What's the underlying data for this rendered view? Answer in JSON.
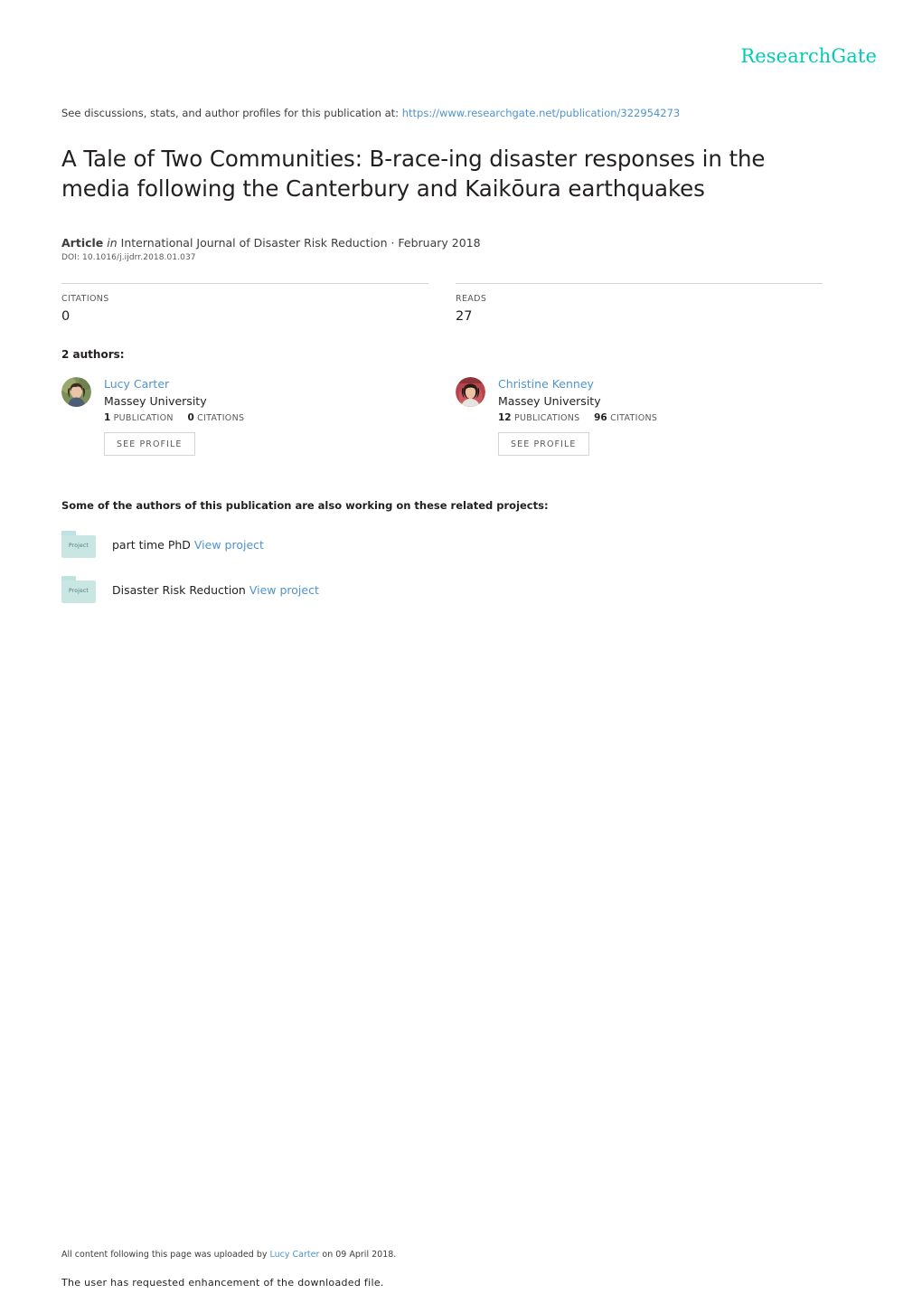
{
  "brand": {
    "logo_text": "ResearchGate",
    "accent_color": "#00ccb4",
    "link_color": "#4f94cd"
  },
  "header": {
    "see_discussions_prefix": "See discussions, stats, and author profiles for this publication at:",
    "publication_url": "https://www.researchgate.net/publication/322954273"
  },
  "publication": {
    "title": "A Tale of Two Communities: B-race-ing disaster responses in the media following the Canterbury and Kaikōura earthquakes",
    "type_label": "Article",
    "in_word": "in",
    "venue": "International Journal of Disaster Risk Reduction · February 2018",
    "doi": "DOI: 10.1016/j.ijdrr.2018.01.037"
  },
  "stats": [
    {
      "label": "CITATIONS",
      "value": "0"
    },
    {
      "label": "READS",
      "value": "27"
    }
  ],
  "authors_section": {
    "heading": "2 authors:",
    "see_profile_label": "SEE PROFILE",
    "authors": [
      {
        "name": "Lucy Carter",
        "affiliation": "Massey University",
        "publications_count": "1",
        "publications_word": "PUBLICATION",
        "citations_count": "0",
        "citations_word": "CITATIONS"
      },
      {
        "name": "Christine Kenney",
        "affiliation": "Massey University",
        "publications_count": "12",
        "publications_word": "PUBLICATIONS",
        "citations_count": "96",
        "citations_word": "CITATIONS"
      }
    ]
  },
  "projects_section": {
    "heading": "Some of the authors of this publication are also working on these related projects:",
    "folder_icon_label": "Project",
    "view_project_label": "View project",
    "projects": [
      {
        "name": "part time PhD"
      },
      {
        "name": "Disaster Risk Reduction"
      }
    ]
  },
  "footer": {
    "uploaded_prefix": "All content following this page was uploaded by",
    "uploader_name": "Lucy Carter",
    "uploaded_suffix": "on 09 April 2018.",
    "enhancement_note": "The user has requested enhancement of the downloaded file."
  }
}
